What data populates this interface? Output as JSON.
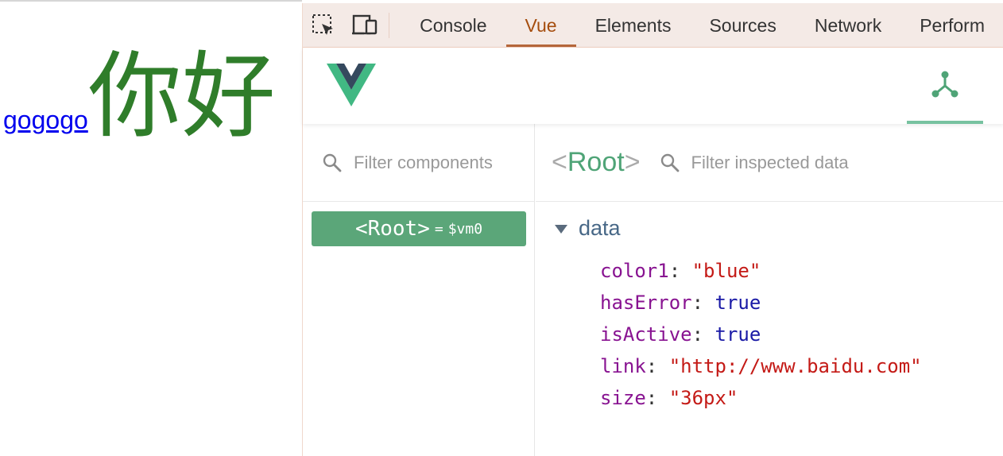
{
  "page": {
    "link_text": "gogogo",
    "big_text": "你好"
  },
  "devtools": {
    "tabs": [
      {
        "label": "Console",
        "active": false
      },
      {
        "label": "Vue",
        "active": true
      },
      {
        "label": "Elements",
        "active": false
      },
      {
        "label": "Sources",
        "active": false
      },
      {
        "label": "Network",
        "active": false
      },
      {
        "label": "Perform",
        "active": false
      }
    ],
    "icons": [
      "inspect-element-icon",
      "device-toggle-icon"
    ],
    "accent": "#a54d0e"
  },
  "vue": {
    "logo": "vue-logo",
    "tree_tab_icon": "component-tree-icon",
    "component_filter_placeholder": "Filter components",
    "inspected_filter_placeholder": "Filter inspected data",
    "inspected": {
      "open": "<",
      "name": "Root",
      "close": ">"
    },
    "selected_component": {
      "name": "<Root>",
      "eq": "=",
      "vm": "$vm0"
    },
    "data_section_label": "data",
    "props": [
      {
        "key": "color1",
        "value": "\"blue\"",
        "kind": "string"
      },
      {
        "key": "hasError",
        "value": "true",
        "kind": "boolean"
      },
      {
        "key": "isActive",
        "value": "true",
        "kind": "boolean"
      },
      {
        "key": "link",
        "value": "\"http://www.baidu.com\"",
        "kind": "string"
      },
      {
        "key": "size",
        "value": "\"36px\"",
        "kind": "string"
      }
    ],
    "colors": {
      "green": "#5ba679",
      "vue_dark": "#35495e",
      "vue_green": "#41b883"
    }
  }
}
